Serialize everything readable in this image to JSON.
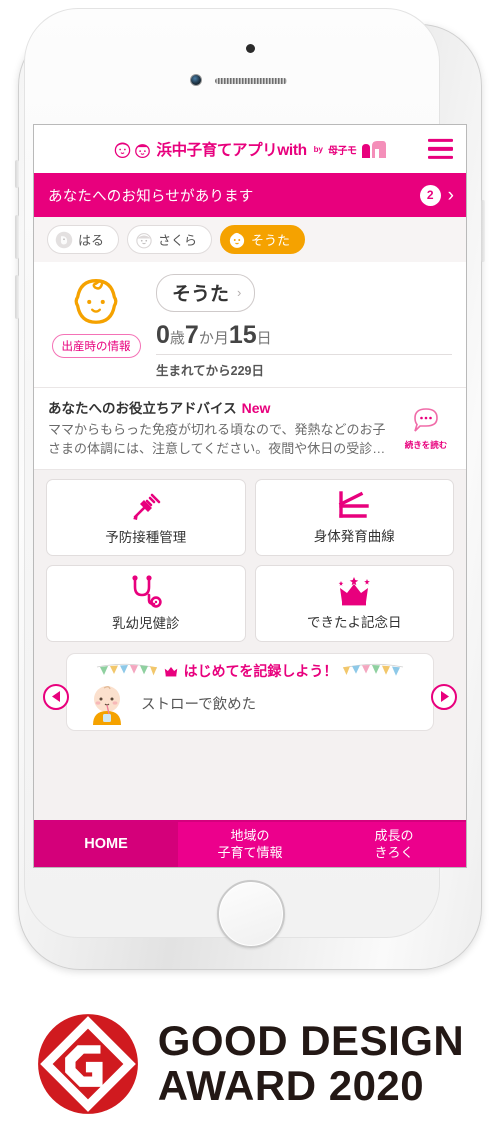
{
  "header": {
    "logo_text": "浜中子育てアプリwith",
    "logo_by": "by",
    "logo_brand": "母子モ",
    "menu_icon": "hamburger-icon"
  },
  "notice": {
    "text": "あなたへのお知らせがあります",
    "count": "2",
    "chevron": "›"
  },
  "children": [
    {
      "name": "はる",
      "active": false
    },
    {
      "name": "さくら",
      "active": false
    },
    {
      "name": "そうた",
      "active": true
    }
  ],
  "profile": {
    "name": "そうた",
    "chevron": "›",
    "birth_info_label": "出産時の情報",
    "age_years": "0",
    "age_years_unit": "歳",
    "age_months": "7",
    "age_months_unit": "か月",
    "age_days": "15",
    "age_days_unit": "日",
    "since_birth": "生まれてから229日"
  },
  "advice": {
    "title": "あなたへのお役立ちアドバイス",
    "new_badge": "New",
    "body": "ママからもらった免疫が切れる頃なので、発熱などのお子さまの体調には、注意してください。夜間や休日の受診…",
    "more_label": "続きを読む"
  },
  "features": [
    {
      "label": "予防接種管理",
      "icon": "syringe-icon"
    },
    {
      "label": "身体発育曲線",
      "icon": "growth-curve-icon"
    },
    {
      "label": "乳幼児健診",
      "icon": "stethoscope-icon"
    },
    {
      "label": "できたよ記念日",
      "icon": "crown-icon"
    }
  ],
  "carousel": {
    "title": "はじめてを記録しよう！",
    "item_label": "ストローで飲めた",
    "prev_icon": "arrow-left-icon",
    "next_icon": "arrow-right-icon"
  },
  "bottom_nav": [
    {
      "line1": "HOME",
      "line2": "",
      "active": true
    },
    {
      "line1": "地域の",
      "line2": "子育て情報",
      "active": false
    },
    {
      "line1": "成長の",
      "line2": "きろく",
      "active": false
    }
  ],
  "award": {
    "line1": "GOOD DESIGN",
    "line2": "AWARD 2020",
    "mark": "good-design-g-mark"
  },
  "colors": {
    "brand_pink": "#e8007d",
    "nav_pink": "#ec008c",
    "nav_active": "#d4007a",
    "accent_orange": "#f5a200",
    "award_red": "#d01a1f"
  }
}
